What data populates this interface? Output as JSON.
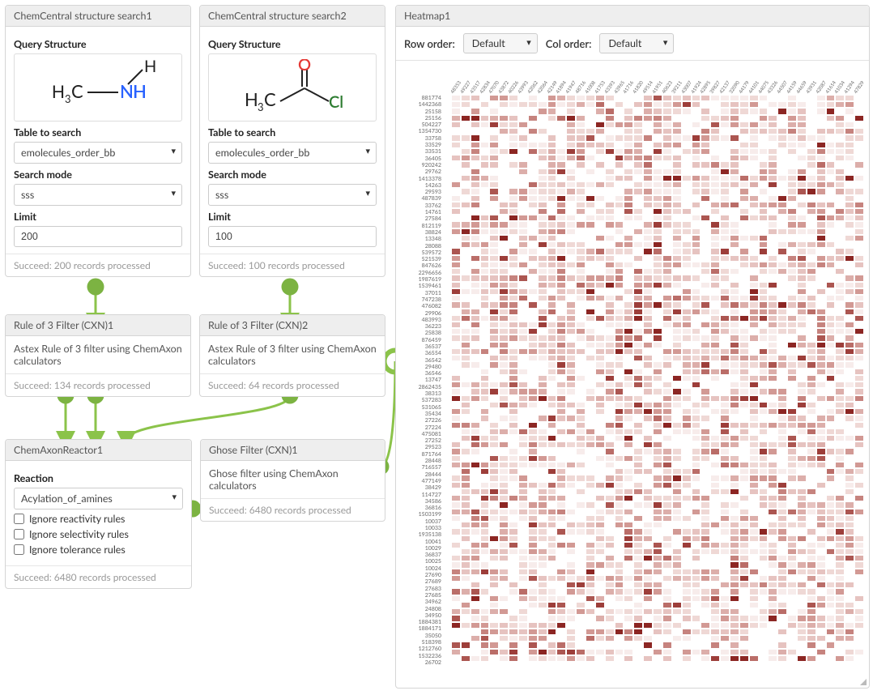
{
  "search1": {
    "title": "ChemCentral structure search1",
    "q_label": "Query Structure",
    "table_label": "Table to search",
    "table_value": "emolecules_order_bb",
    "mode_label": "Search mode",
    "mode_value": "sss",
    "limit_label": "Limit",
    "limit_value": "200",
    "status": "Succeed: 200 records processed"
  },
  "search2": {
    "title": "ChemCentral structure search2",
    "q_label": "Query Structure",
    "table_label": "Table to search",
    "table_value": "emolecules_order_bb",
    "mode_label": "Search mode",
    "mode_value": "sss",
    "limit_label": "Limit",
    "limit_value": "100",
    "status": "Succeed: 100 records processed"
  },
  "rule1": {
    "title": "Rule of 3 Filter (CXN)1",
    "desc": "Astex Rule of 3 filter using ChemAxon calculators",
    "status": "Succeed: 134 records processed"
  },
  "rule2": {
    "title": "Rule of 3 Filter (CXN)2",
    "desc": "Astex Rule of 3 filter using ChemAxon calculators",
    "status": "Succeed: 64 records processed"
  },
  "reactor": {
    "title": "ChemAxonReactor1",
    "reaction_label": "Reaction",
    "reaction_value": "Acylation_of_amines",
    "opt1": "Ignore reactivity rules",
    "opt2": "Ignore selectivity rules",
    "opt3": "Ignore tolerance rules",
    "status": "Succeed: 6480 records processed"
  },
  "ghose": {
    "title": "Ghose Filter (CXN)1",
    "desc": "Ghose filter using ChemAxon calculators",
    "status": "Succeed: 6480 records processed"
  },
  "heatmap": {
    "title": "Heatmap1",
    "row_label": "Row order:",
    "row_value": "Default",
    "col_label": "Col order:",
    "col_value": "Default",
    "row_ids": [
      "881774",
      "1442368",
      "25158",
      "25156",
      "504227",
      "1354730",
      "33758",
      "33529",
      "33531",
      "36405",
      "920242",
      "29762",
      "1413378",
      "14263",
      "29593",
      "487839",
      "33762",
      "14761",
      "27584",
      "812119",
      "38824",
      "13348",
      "28088",
      "539572",
      "521539",
      "847626",
      "2296656",
      "1987619",
      "1539461",
      "37011",
      "747238",
      "476082",
      "29906",
      "483993",
      "36223",
      "25838",
      "876459",
      "36537",
      "36554",
      "36542",
      "29480",
      "36546",
      "13747",
      "2862435",
      "38313",
      "537283",
      "531065",
      "35434",
      "27226",
      "27224",
      "475081",
      "27252",
      "29523",
      "871764",
      "28448",
      "716557",
      "28444",
      "477149",
      "38429",
      "114727",
      "34586",
      "36816",
      "1503199",
      "10037",
      "10033",
      "1935138",
      "10041",
      "10029",
      "36837",
      "10025",
      "10024",
      "27690",
      "27689",
      "27683",
      "27685",
      "34962",
      "24808",
      "34950",
      "1884381",
      "1884171",
      "35050",
      "518398",
      "1212760",
      "1532236",
      "26702"
    ],
    "col_ids": [
      "48353",
      "49227",
      "43517",
      "42834",
      "47070",
      "43872",
      "40226",
      "43993",
      "42062",
      "42064",
      "42149",
      "41894",
      "41947",
      "48716",
      "41008",
      "41753",
      "43393",
      "43965",
      "41716",
      "41820",
      "49514",
      "41951",
      "40623",
      "39211",
      "43007",
      "41924",
      "42895",
      "39827",
      "42137",
      "32090",
      "44179",
      "44101",
      "44075",
      "43326",
      "44507",
      "44159",
      "44659",
      "43931",
      "42087",
      "41614",
      "41034",
      "41294",
      "47829"
    ],
    "palette": [
      "#ffffff",
      "#f7eceb",
      "#efd8d5",
      "#e6c3c0",
      "#dcaeaa",
      "#d29994",
      "#c6837e",
      "#ba6d68",
      "#ac5651",
      "#9d3e3a",
      "#8c2623"
    ]
  }
}
